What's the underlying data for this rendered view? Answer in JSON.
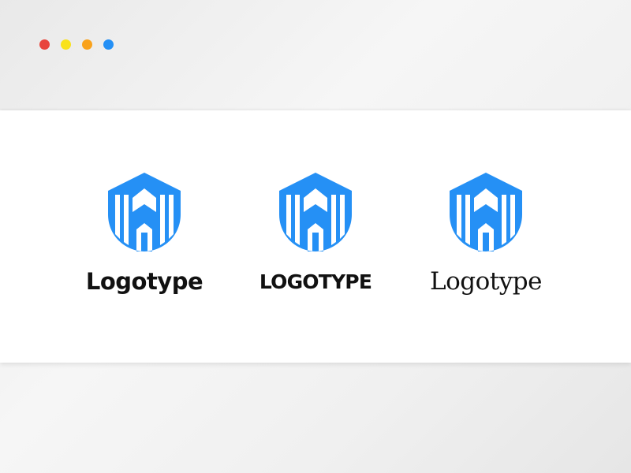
{
  "window_controls": [
    {
      "name": "red-dot",
      "color": "#e8453c"
    },
    {
      "name": "yellow-dot",
      "color": "#f9e21c"
    },
    {
      "name": "orange-dot",
      "color": "#f9a21c"
    },
    {
      "name": "blue-dot",
      "color": "#2590f5"
    }
  ],
  "colors": {
    "brand_blue": "#2590f5",
    "panel_background": "#ffffff",
    "text": "#111111"
  },
  "logos": [
    {
      "icon": "shield-building-icon",
      "wordmark": "Logotype"
    },
    {
      "icon": "shield-building-icon",
      "wordmark": "LOGOTYPE"
    },
    {
      "icon": "shield-building-icon",
      "wordmark": "Logotype"
    }
  ]
}
